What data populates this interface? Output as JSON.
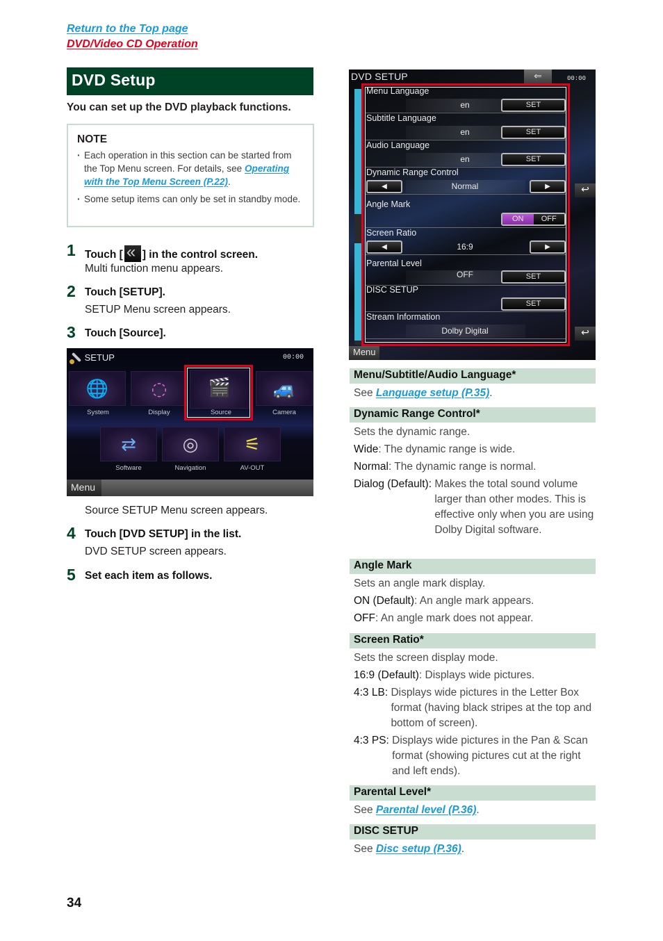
{
  "nav": {
    "top_page_link": "Return to the Top page",
    "section_link": "DVD/Video CD Operation"
  },
  "section": {
    "title": "DVD Setup",
    "intro": "You can set up the DVD playback functions."
  },
  "note": {
    "title": "NOTE",
    "items": [
      {
        "text_before": "Each operation in this section can be started from the Top Menu screen. For details, see ",
        "link": "Operating with the Top Menu Screen (P.22)",
        "text_after": "."
      },
      {
        "text_before": "Some setup items can only be set in standby mode.",
        "link": "",
        "text_after": ""
      }
    ]
  },
  "steps": [
    {
      "num": "1",
      "text_before": "Touch [",
      "icon": "multi-function-icon",
      "text_after": "] in the control screen.",
      "sub": "Multi function menu appears."
    },
    {
      "num": "2",
      "text": "Touch [SETUP].",
      "sub": "SETUP Menu screen appears."
    },
    {
      "num": "3",
      "text": "Touch [Source].",
      "sub": ""
    },
    {
      "num": "4",
      "text": "Touch [DVD SETUP] in the list.",
      "sub": "DVD SETUP screen appears."
    },
    {
      "num": "5",
      "text": "Set each item as follows.",
      "sub": ""
    }
  ],
  "setup_screen": {
    "title": "SETUP",
    "clock": "00:00",
    "tiles": [
      {
        "label": "System",
        "icon": "globe-icon"
      },
      {
        "label": "Display",
        "icon": "display-icon"
      },
      {
        "label": "Source",
        "icon": "clapperboard-icon",
        "selected": true
      },
      {
        "label": "Camera",
        "icon": "camera-icon"
      },
      {
        "label": "Software",
        "icon": "usb-icon"
      },
      {
        "label": "Navigation",
        "icon": "compass-icon"
      },
      {
        "label": "AV-OUT",
        "icon": "rca-cable-icon"
      }
    ],
    "menu_label": "Menu",
    "after_text": "Source SETUP Menu screen appears."
  },
  "dvd_screen": {
    "title": "DVD SETUP",
    "clock": "00:00",
    "menu_label": "Menu",
    "set_label": "SET",
    "rows": [
      {
        "label": "Menu Language",
        "value": "en",
        "control": "set"
      },
      {
        "label": "Subtitle Language",
        "value": "en",
        "control": "set"
      },
      {
        "label": "Audio Language",
        "value": "en",
        "control": "set"
      },
      {
        "label": "Dynamic Range Control",
        "value": "Normal",
        "control": "arrows"
      },
      {
        "label": "Angle Mark",
        "value": "",
        "control": "toggle",
        "on_label": "ON",
        "off_label": "OFF",
        "selected": "ON"
      },
      {
        "label": "Screen Ratio",
        "value": "16:9",
        "control": "arrows"
      },
      {
        "label": "Parental Level",
        "value": "OFF",
        "control": "set"
      },
      {
        "label": "DISC SETUP",
        "value": "",
        "control": "set"
      },
      {
        "label": "Stream Information",
        "value": "Dolby Digital",
        "control": "none"
      }
    ]
  },
  "descriptions": {
    "language": {
      "head": "Menu/Subtitle/Audio Language*",
      "see": "See ",
      "link": "Language setup (P.35)",
      "end": "."
    },
    "drc": {
      "head": "Dynamic Range Control*",
      "intro": "Sets the dynamic range.",
      "options": [
        {
          "term": "Wide",
          "def": ": The dynamic range is wide."
        },
        {
          "term": "Normal",
          "def": ": The dynamic range is normal."
        },
        {
          "term": "Dialog (Default)",
          "def": "Makes the total sound volume larger than other modes. This is effective only when you are using Dolby Digital software."
        }
      ]
    },
    "angle": {
      "head": "Angle Mark",
      "intro": "Sets an angle mark display.",
      "options": [
        {
          "term": "ON (Default)",
          "def": ": An angle mark appears."
        },
        {
          "term": "OFF",
          "def": ": An angle mark does not appear."
        }
      ]
    },
    "ratio": {
      "head": "Screen Ratio*",
      "intro": "Sets the screen display mode.",
      "options": [
        {
          "term": "16:9 (Default)",
          "def": ": Displays wide pictures."
        },
        {
          "term": "4:3 LB",
          "def": "Displays wide pictures in the Letter Box format (having black stripes at the top and bottom of screen)."
        },
        {
          "term": "4:3 PS",
          "def": "Displays wide pictures in the Pan & Scan format (showing pictures cut at the right and left ends)."
        }
      ]
    },
    "parental": {
      "head": "Parental Level*",
      "see": "See ",
      "link": "Parental level (P.36)",
      "end": "."
    },
    "disc": {
      "head": "DISC SETUP",
      "see": "See ",
      "link": "Disc setup (P.36)",
      "end": "."
    }
  },
  "page_number": "34",
  "colors": {
    "header_green": "#004225",
    "band_green": "#c9ddd1",
    "link_blue": "#1a9ad6",
    "link_red": "#e2001a",
    "highlight_red": "#e2001a",
    "toggle_on": "#a040c0"
  }
}
